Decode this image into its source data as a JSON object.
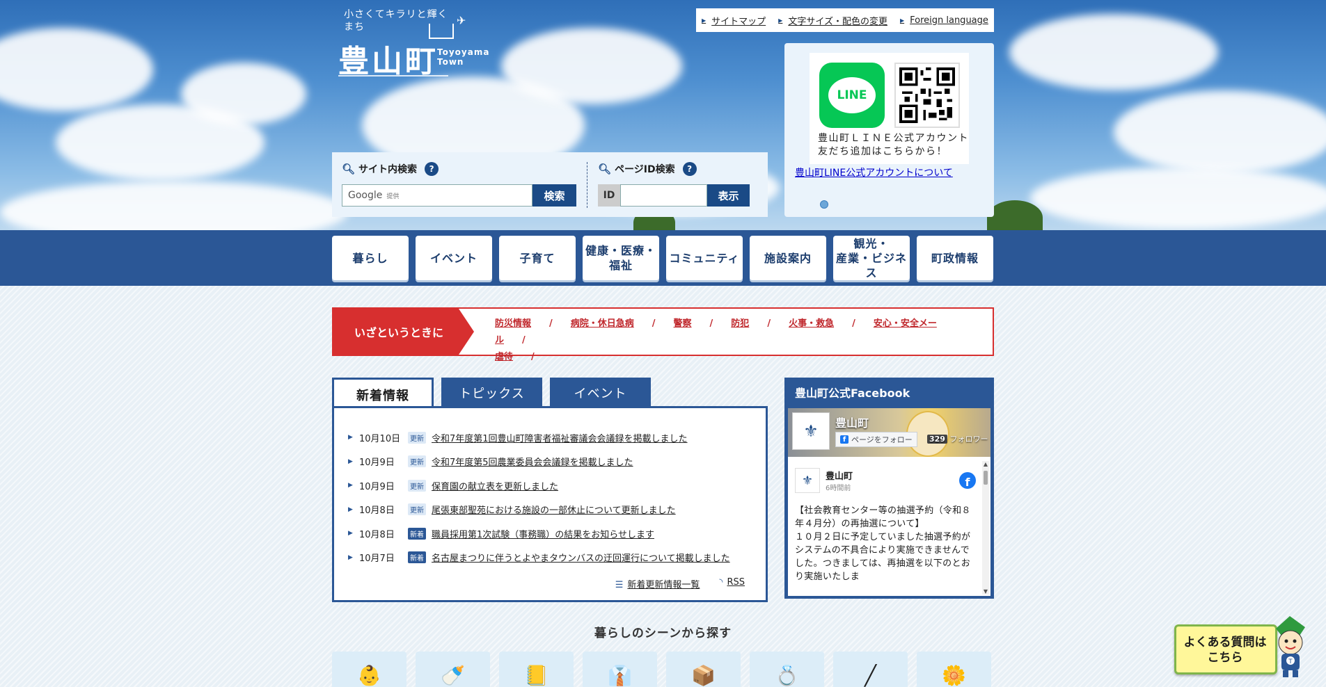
{
  "brand": {
    "tagline": "小さくてキラリと輝くまち",
    "name": "豊山町",
    "roman": "Toyoyama Town"
  },
  "utility_links": [
    "サイトマップ",
    "文字サイズ・配色の変更",
    "Foreign language"
  ],
  "line_banner": {
    "logo_text": "LINE",
    "caption_line1": "豊山町ＬＩＮＥ公式アカウント",
    "caption_line2": "友だち追加はこちらから！",
    "link": "豊山町LINE公式アカウントについて"
  },
  "search": {
    "site_title": "サイト内検索",
    "google": "Google",
    "powered": "提供",
    "site_button": "検索",
    "id_title": "ページID検索",
    "id_label": "ID",
    "id_button": "表示",
    "help": "?"
  },
  "nav": [
    "暮らし",
    "イベント",
    "子育て",
    "健康・医療・\n福祉",
    "コミュニティ",
    "施設案内",
    "観光・\n産業・ビジネス",
    "町政情報"
  ],
  "emergency": {
    "heading": "いざというときに",
    "links": [
      "防災情報",
      "病院・休日急病",
      "警察",
      "防犯",
      "火事・救急",
      "安心・安全メール",
      "虐待"
    ]
  },
  "tabs": [
    "新着情報",
    "トピックス",
    "イベント"
  ],
  "news": [
    {
      "date": "10月10日",
      "badge": "更新",
      "type": "upd",
      "title": "令和7年度第1回豊山町障害者福祉審議会会議録を掲載しました"
    },
    {
      "date": "10月9日",
      "badge": "更新",
      "type": "upd",
      "title": "令和7年度第5回農業委員会会議録を掲載しました"
    },
    {
      "date": "10月9日",
      "badge": "更新",
      "type": "upd",
      "title": "保育園の献立表を更新しました"
    },
    {
      "date": "10月8日",
      "badge": "更新",
      "type": "upd",
      "title": "尾張東部聖苑における施設の一部休止について更新しました"
    },
    {
      "date": "10月8日",
      "badge": "新着",
      "type": "new",
      "title": "職員採用第1次試験（事務職）の結果をお知らせします"
    },
    {
      "date": "10月7日",
      "badge": "新着",
      "type": "new",
      "title": "名古屋まつりに伴うとよやまタウンバスの迂回運行について掲載しました"
    }
  ],
  "news_footer": {
    "list": "新着更新情報一覧",
    "rss": "RSS"
  },
  "facebook": {
    "title": "豊山町公式Facebook",
    "page_name": "豊山町",
    "follow": "ページをフォロー",
    "followers_count": "329",
    "followers_label": "フォロワー",
    "post_author": "豊山町",
    "post_time": "6時間前",
    "post_text": "【社会教育センター等の抽選予約（令和８年４月分）の再抽選について】\n１０月２日に予定していました抽選予約がシステムの不具合により実施できませんでした。つきましては、再抽選を以下のとおり実施いたしま"
  },
  "scene_heading": "暮らしのシーンから探す",
  "scenes": [
    "baby-icon",
    "bottle-icon",
    "notebook-icon",
    "suit-icon",
    "box-icon",
    "ring-icon",
    "cane-icon",
    "flower-icon"
  ],
  "faq": {
    "line1": "よくある質問は",
    "line2": "こちら"
  },
  "colors": {
    "navy": "#2b5796",
    "red": "#d72f2f",
    "line_green": "#06c755",
    "fb_blue": "#1877f2"
  }
}
